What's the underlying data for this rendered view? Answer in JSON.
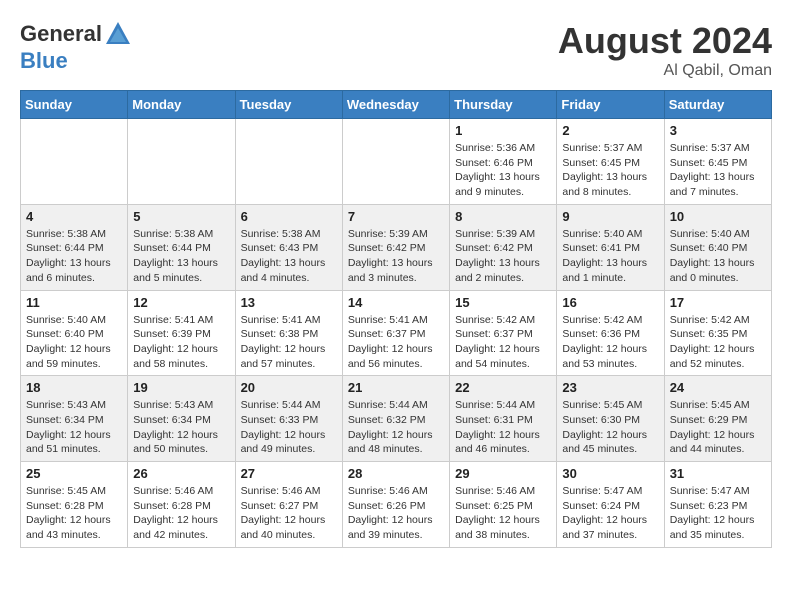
{
  "logo": {
    "general": "General",
    "blue": "Blue"
  },
  "title": {
    "month_year": "August 2024",
    "location": "Al Qabil, Oman"
  },
  "days_of_week": [
    "Sunday",
    "Monday",
    "Tuesday",
    "Wednesday",
    "Thursday",
    "Friday",
    "Saturday"
  ],
  "weeks": [
    [
      {
        "day": "",
        "info": ""
      },
      {
        "day": "",
        "info": ""
      },
      {
        "day": "",
        "info": ""
      },
      {
        "day": "",
        "info": ""
      },
      {
        "day": "1",
        "info": "Sunrise: 5:36 AM\nSunset: 6:46 PM\nDaylight: 13 hours\nand 9 minutes."
      },
      {
        "day": "2",
        "info": "Sunrise: 5:37 AM\nSunset: 6:45 PM\nDaylight: 13 hours\nand 8 minutes."
      },
      {
        "day": "3",
        "info": "Sunrise: 5:37 AM\nSunset: 6:45 PM\nDaylight: 13 hours\nand 7 minutes."
      }
    ],
    [
      {
        "day": "4",
        "info": "Sunrise: 5:38 AM\nSunset: 6:44 PM\nDaylight: 13 hours\nand 6 minutes."
      },
      {
        "day": "5",
        "info": "Sunrise: 5:38 AM\nSunset: 6:44 PM\nDaylight: 13 hours\nand 5 minutes."
      },
      {
        "day": "6",
        "info": "Sunrise: 5:38 AM\nSunset: 6:43 PM\nDaylight: 13 hours\nand 4 minutes."
      },
      {
        "day": "7",
        "info": "Sunrise: 5:39 AM\nSunset: 6:42 PM\nDaylight: 13 hours\nand 3 minutes."
      },
      {
        "day": "8",
        "info": "Sunrise: 5:39 AM\nSunset: 6:42 PM\nDaylight: 13 hours\nand 2 minutes."
      },
      {
        "day": "9",
        "info": "Sunrise: 5:40 AM\nSunset: 6:41 PM\nDaylight: 13 hours\nand 1 minute."
      },
      {
        "day": "10",
        "info": "Sunrise: 5:40 AM\nSunset: 6:40 PM\nDaylight: 13 hours\nand 0 minutes."
      }
    ],
    [
      {
        "day": "11",
        "info": "Sunrise: 5:40 AM\nSunset: 6:40 PM\nDaylight: 12 hours\nand 59 minutes."
      },
      {
        "day": "12",
        "info": "Sunrise: 5:41 AM\nSunset: 6:39 PM\nDaylight: 12 hours\nand 58 minutes."
      },
      {
        "day": "13",
        "info": "Sunrise: 5:41 AM\nSunset: 6:38 PM\nDaylight: 12 hours\nand 57 minutes."
      },
      {
        "day": "14",
        "info": "Sunrise: 5:41 AM\nSunset: 6:37 PM\nDaylight: 12 hours\nand 56 minutes."
      },
      {
        "day": "15",
        "info": "Sunrise: 5:42 AM\nSunset: 6:37 PM\nDaylight: 12 hours\nand 54 minutes."
      },
      {
        "day": "16",
        "info": "Sunrise: 5:42 AM\nSunset: 6:36 PM\nDaylight: 12 hours\nand 53 minutes."
      },
      {
        "day": "17",
        "info": "Sunrise: 5:42 AM\nSunset: 6:35 PM\nDaylight: 12 hours\nand 52 minutes."
      }
    ],
    [
      {
        "day": "18",
        "info": "Sunrise: 5:43 AM\nSunset: 6:34 PM\nDaylight: 12 hours\nand 51 minutes."
      },
      {
        "day": "19",
        "info": "Sunrise: 5:43 AM\nSunset: 6:34 PM\nDaylight: 12 hours\nand 50 minutes."
      },
      {
        "day": "20",
        "info": "Sunrise: 5:44 AM\nSunset: 6:33 PM\nDaylight: 12 hours\nand 49 minutes."
      },
      {
        "day": "21",
        "info": "Sunrise: 5:44 AM\nSunset: 6:32 PM\nDaylight: 12 hours\nand 48 minutes."
      },
      {
        "day": "22",
        "info": "Sunrise: 5:44 AM\nSunset: 6:31 PM\nDaylight: 12 hours\nand 46 minutes."
      },
      {
        "day": "23",
        "info": "Sunrise: 5:45 AM\nSunset: 6:30 PM\nDaylight: 12 hours\nand 45 minutes."
      },
      {
        "day": "24",
        "info": "Sunrise: 5:45 AM\nSunset: 6:29 PM\nDaylight: 12 hours\nand 44 minutes."
      }
    ],
    [
      {
        "day": "25",
        "info": "Sunrise: 5:45 AM\nSunset: 6:28 PM\nDaylight: 12 hours\nand 43 minutes."
      },
      {
        "day": "26",
        "info": "Sunrise: 5:46 AM\nSunset: 6:28 PM\nDaylight: 12 hours\nand 42 minutes."
      },
      {
        "day": "27",
        "info": "Sunrise: 5:46 AM\nSunset: 6:27 PM\nDaylight: 12 hours\nand 40 minutes."
      },
      {
        "day": "28",
        "info": "Sunrise: 5:46 AM\nSunset: 6:26 PM\nDaylight: 12 hours\nand 39 minutes."
      },
      {
        "day": "29",
        "info": "Sunrise: 5:46 AM\nSunset: 6:25 PM\nDaylight: 12 hours\nand 38 minutes."
      },
      {
        "day": "30",
        "info": "Sunrise: 5:47 AM\nSunset: 6:24 PM\nDaylight: 12 hours\nand 37 minutes."
      },
      {
        "day": "31",
        "info": "Sunrise: 5:47 AM\nSunset: 6:23 PM\nDaylight: 12 hours\nand 35 minutes."
      }
    ]
  ]
}
